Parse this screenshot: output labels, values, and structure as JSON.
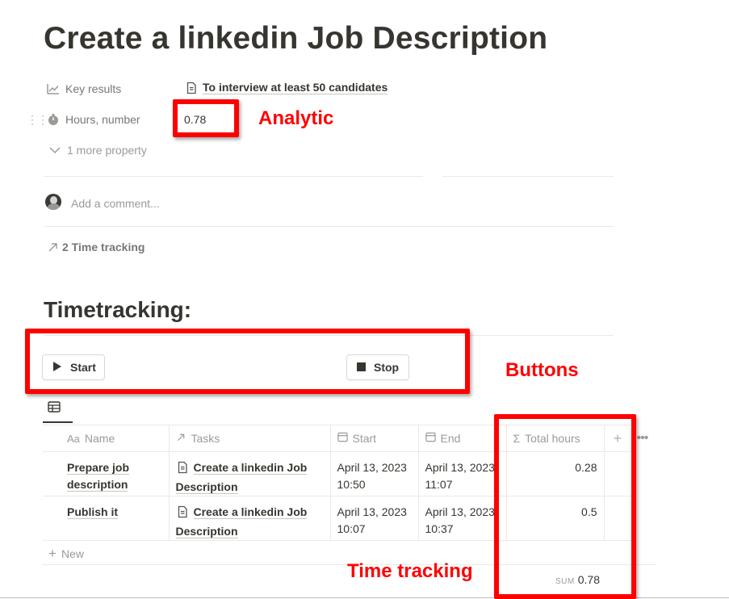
{
  "page": {
    "title": "Create a linkedin Job Description"
  },
  "properties": [
    {
      "label": "Key results",
      "icon": "trending-up-icon",
      "value": "To interview at least 50 candidates"
    },
    {
      "label": "Hours, number",
      "icon": "stopwatch-icon",
      "value": "0.78"
    }
  ],
  "more_property": "1 more property",
  "comment": {
    "placeholder": "Add a comment..."
  },
  "relation_link": "2 Time tracking",
  "section_title": "Timetracking:",
  "buttons": {
    "start": "Start",
    "stop": "Stop"
  },
  "annotations": {
    "analytic": "Analytic",
    "buttons": "Buttons",
    "time_tracking": "Time tracking"
  },
  "table": {
    "view_icon": "table-icon",
    "columns": [
      {
        "icon": "Aa",
        "label": "Name"
      },
      {
        "icon": "arrow-up-right-icon",
        "label": "Tasks"
      },
      {
        "icon": "calendar-icon",
        "label": "Start"
      },
      {
        "icon": "calendar-icon",
        "label": "End"
      },
      {
        "icon": "Σ",
        "label": "Total hours"
      }
    ],
    "rows": [
      {
        "name": "Prepare job description",
        "task": "Create a linkedin Job Description",
        "start": "April 13, 2023 10:50",
        "end": "April 13, 2023 11:07",
        "total": "0.28"
      },
      {
        "name": "Publish it",
        "task": "Create a linkedin Job Description",
        "start": "April 13, 2023 10:07",
        "end": "April 13, 2023 10:37",
        "total": "0.5"
      }
    ],
    "new_label": "New",
    "sum_label": "SUM",
    "sum_value": "0.78"
  },
  "colors": {
    "annotation_red": "#ff0000",
    "text": "#37352f",
    "muted": "#787774"
  }
}
